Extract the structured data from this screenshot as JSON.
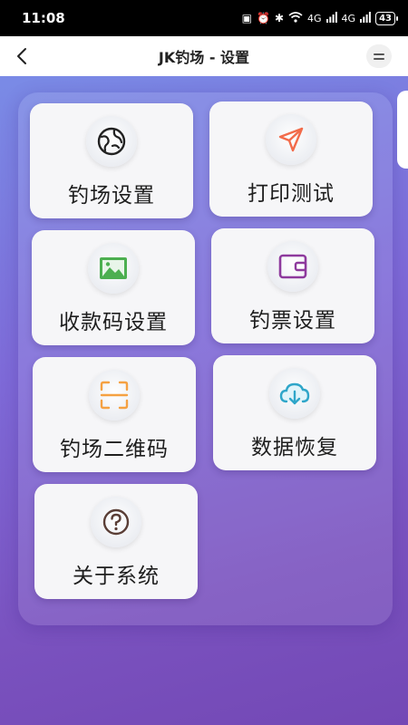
{
  "status_bar": {
    "time": "11:08",
    "icons": [
      "nfc-icon",
      "alarm-icon",
      "bluetooth-icon",
      "wifi-icon",
      "signal-icon"
    ],
    "signal_1": "4G",
    "signal_2": "4G",
    "battery": "43"
  },
  "header": {
    "title": "JK钓场 - 设置"
  },
  "tiles": [
    {
      "label": "钓场设置",
      "icon": "globe-icon",
      "color": "#222222"
    },
    {
      "label": "打印测试",
      "icon": "send-icon",
      "color": "#f26b4a"
    },
    {
      "label": "收款码设置",
      "icon": "image-icon",
      "color": "#4caf50"
    },
    {
      "label": "钓票设置",
      "icon": "wallet-icon",
      "color": "#8e3a9d"
    },
    {
      "label": "钓场二维码",
      "icon": "scan-icon",
      "color": "#f5a142"
    },
    {
      "label": "数据恢复",
      "icon": "cloud-download-icon",
      "color": "#2fa6c9"
    },
    {
      "label": "关于系统",
      "icon": "help-icon",
      "color": "#5a3e36"
    }
  ]
}
